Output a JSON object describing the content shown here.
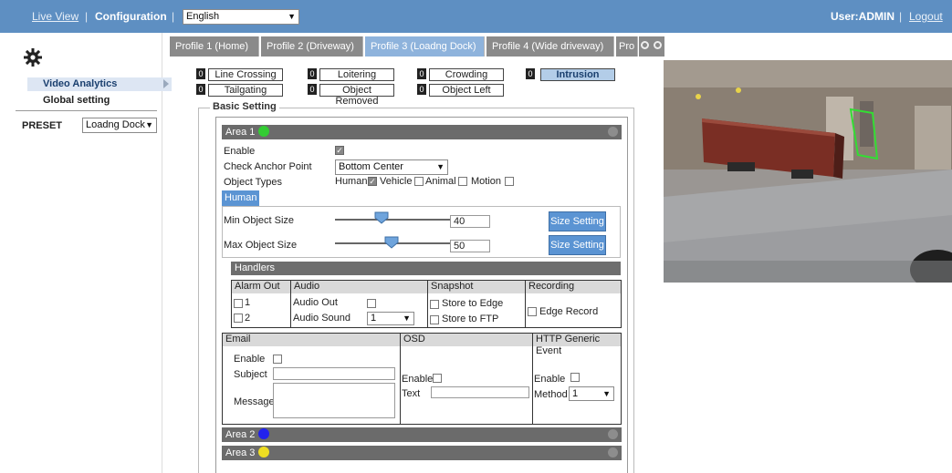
{
  "topbar": {
    "live_view": "Live View",
    "separator": "|",
    "configuration": "Configuration",
    "language": "English",
    "user": "User:ADMIN",
    "logout": "Logout"
  },
  "left": {
    "video_analytics": "Video Analytics",
    "global_setting": "Global setting",
    "preset_label": "PRESET",
    "preset_value": "Loadng Dock"
  },
  "tabs": [
    {
      "label": "Profile 1  (Home)"
    },
    {
      "label": "Profile 2  (Driveway)"
    },
    {
      "label": "Profile 3  (Loadng Dock)"
    },
    {
      "label": "Profile 4  (Wide driveway)"
    },
    {
      "label": "Pro"
    }
  ],
  "rules": [
    {
      "count": "0",
      "label": "Line Crossing"
    },
    {
      "count": "0",
      "label": "Loitering"
    },
    {
      "count": "0",
      "label": "Crowding"
    },
    {
      "count": "0",
      "label": "Intrusion"
    },
    {
      "count": "0",
      "label": "Tailgating"
    },
    {
      "count": "0",
      "label": "Object Removed"
    },
    {
      "count": "0",
      "label": "Object Left"
    }
  ],
  "basic": {
    "legend": "Basic Setting",
    "area1": "Area 1",
    "area2": "Area 2",
    "area3": "Area 3",
    "enable": "Enable",
    "check_anchor": "Check Anchor Point",
    "anchor_value": "Bottom Center",
    "object_types": "Object Types",
    "types": {
      "human": "Human",
      "vehicle": "Vehicle",
      "animal": "Animal",
      "motion": "Motion"
    },
    "human_tab": "Human",
    "min_size_label": "Min Object Size",
    "min_size_value": "40",
    "max_size_label": "Max Object Size",
    "max_size_value": "50",
    "size_setting": "Size Setting"
  },
  "handlers": {
    "title": "Handlers",
    "alarm_out": "Alarm Out",
    "alarm1": "1",
    "alarm2": "2",
    "audio": "Audio",
    "audio_out": "Audio Out",
    "audio_sound": "Audio Sound",
    "audio_sound_value": "1",
    "snapshot": "Snapshot",
    "store_edge": "Store to Edge",
    "store_ftp": "Store to FTP",
    "recording": "Recording",
    "edge_record": "Edge Record",
    "email": "Email",
    "email_enable": "Enable",
    "subject": "Subject",
    "message": "Message",
    "osd": "OSD",
    "osd_enable": "Enable",
    "osd_text": "Text",
    "http": "HTTP Generic Event",
    "http_enable": "Enable",
    "method": "Method",
    "method_value": "1"
  },
  "colors": {
    "topbar": "#5e8fc2",
    "area1_dot": "#33cc33",
    "area2_dot": "#2222ee",
    "area3_dot": "#eedd22",
    "zone": "#33dd33"
  }
}
